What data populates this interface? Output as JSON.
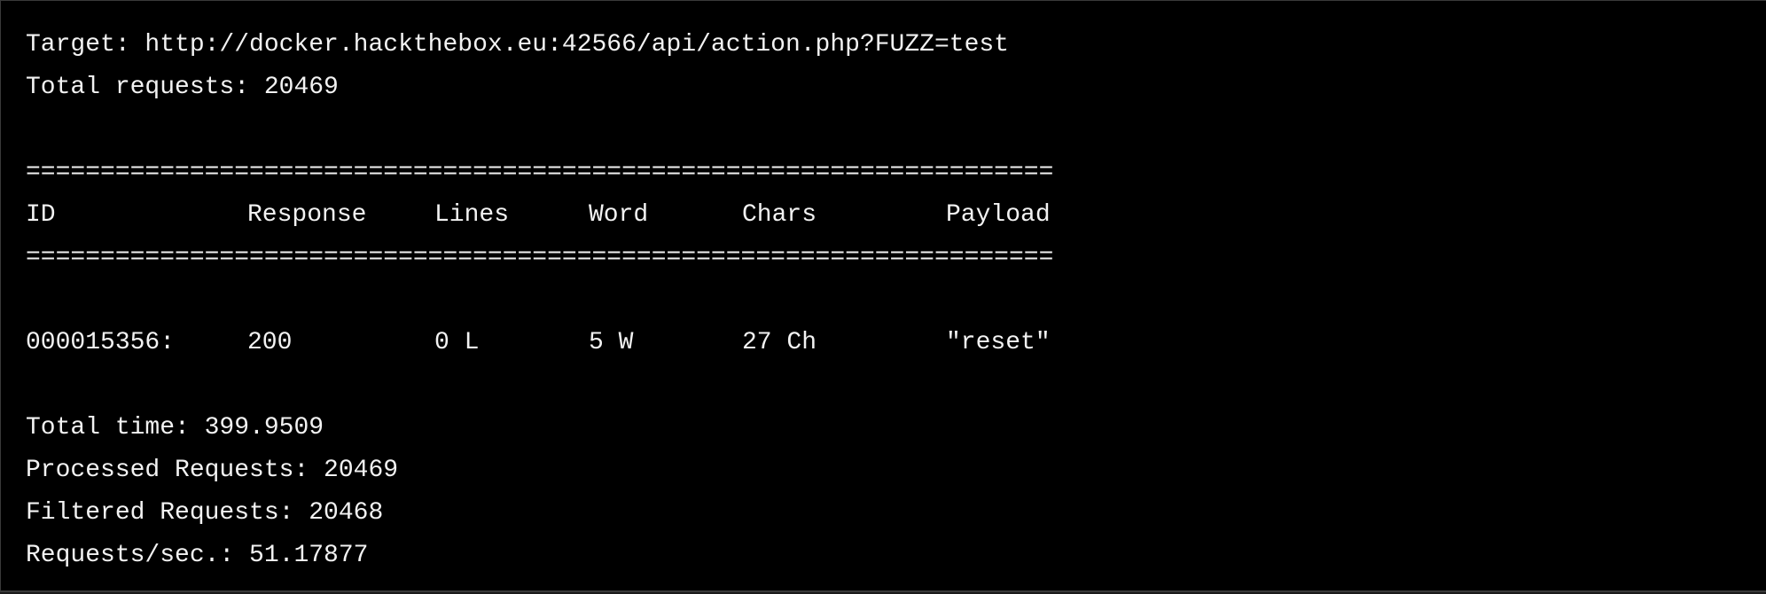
{
  "header": {
    "target": "Target: http://docker.hackthebox.eu:42566/api/action.php?FUZZ=test",
    "total_requests": "Total requests: 20469"
  },
  "separator": "=====================================================================",
  "columns": {
    "id": "ID",
    "response": "Response",
    "lines": "Lines",
    "word": "Word",
    "chars": "Chars",
    "payload": "Payload"
  },
  "results": [
    {
      "id": "000015356:",
      "response": "200",
      "lines": "0 L",
      "word": "5 W",
      "chars": "27 Ch",
      "payload": "\"reset\""
    }
  ],
  "summary": {
    "total_time": "Total time: 399.9509",
    "processed": "Processed Requests: 20469",
    "filtered": "Filtered Requests: 20468",
    "rate": "Requests/sec.: 51.17877"
  },
  "colors": {
    "background": "#000000",
    "text": "#f2f2f2",
    "border": "#3a3a3a"
  }
}
